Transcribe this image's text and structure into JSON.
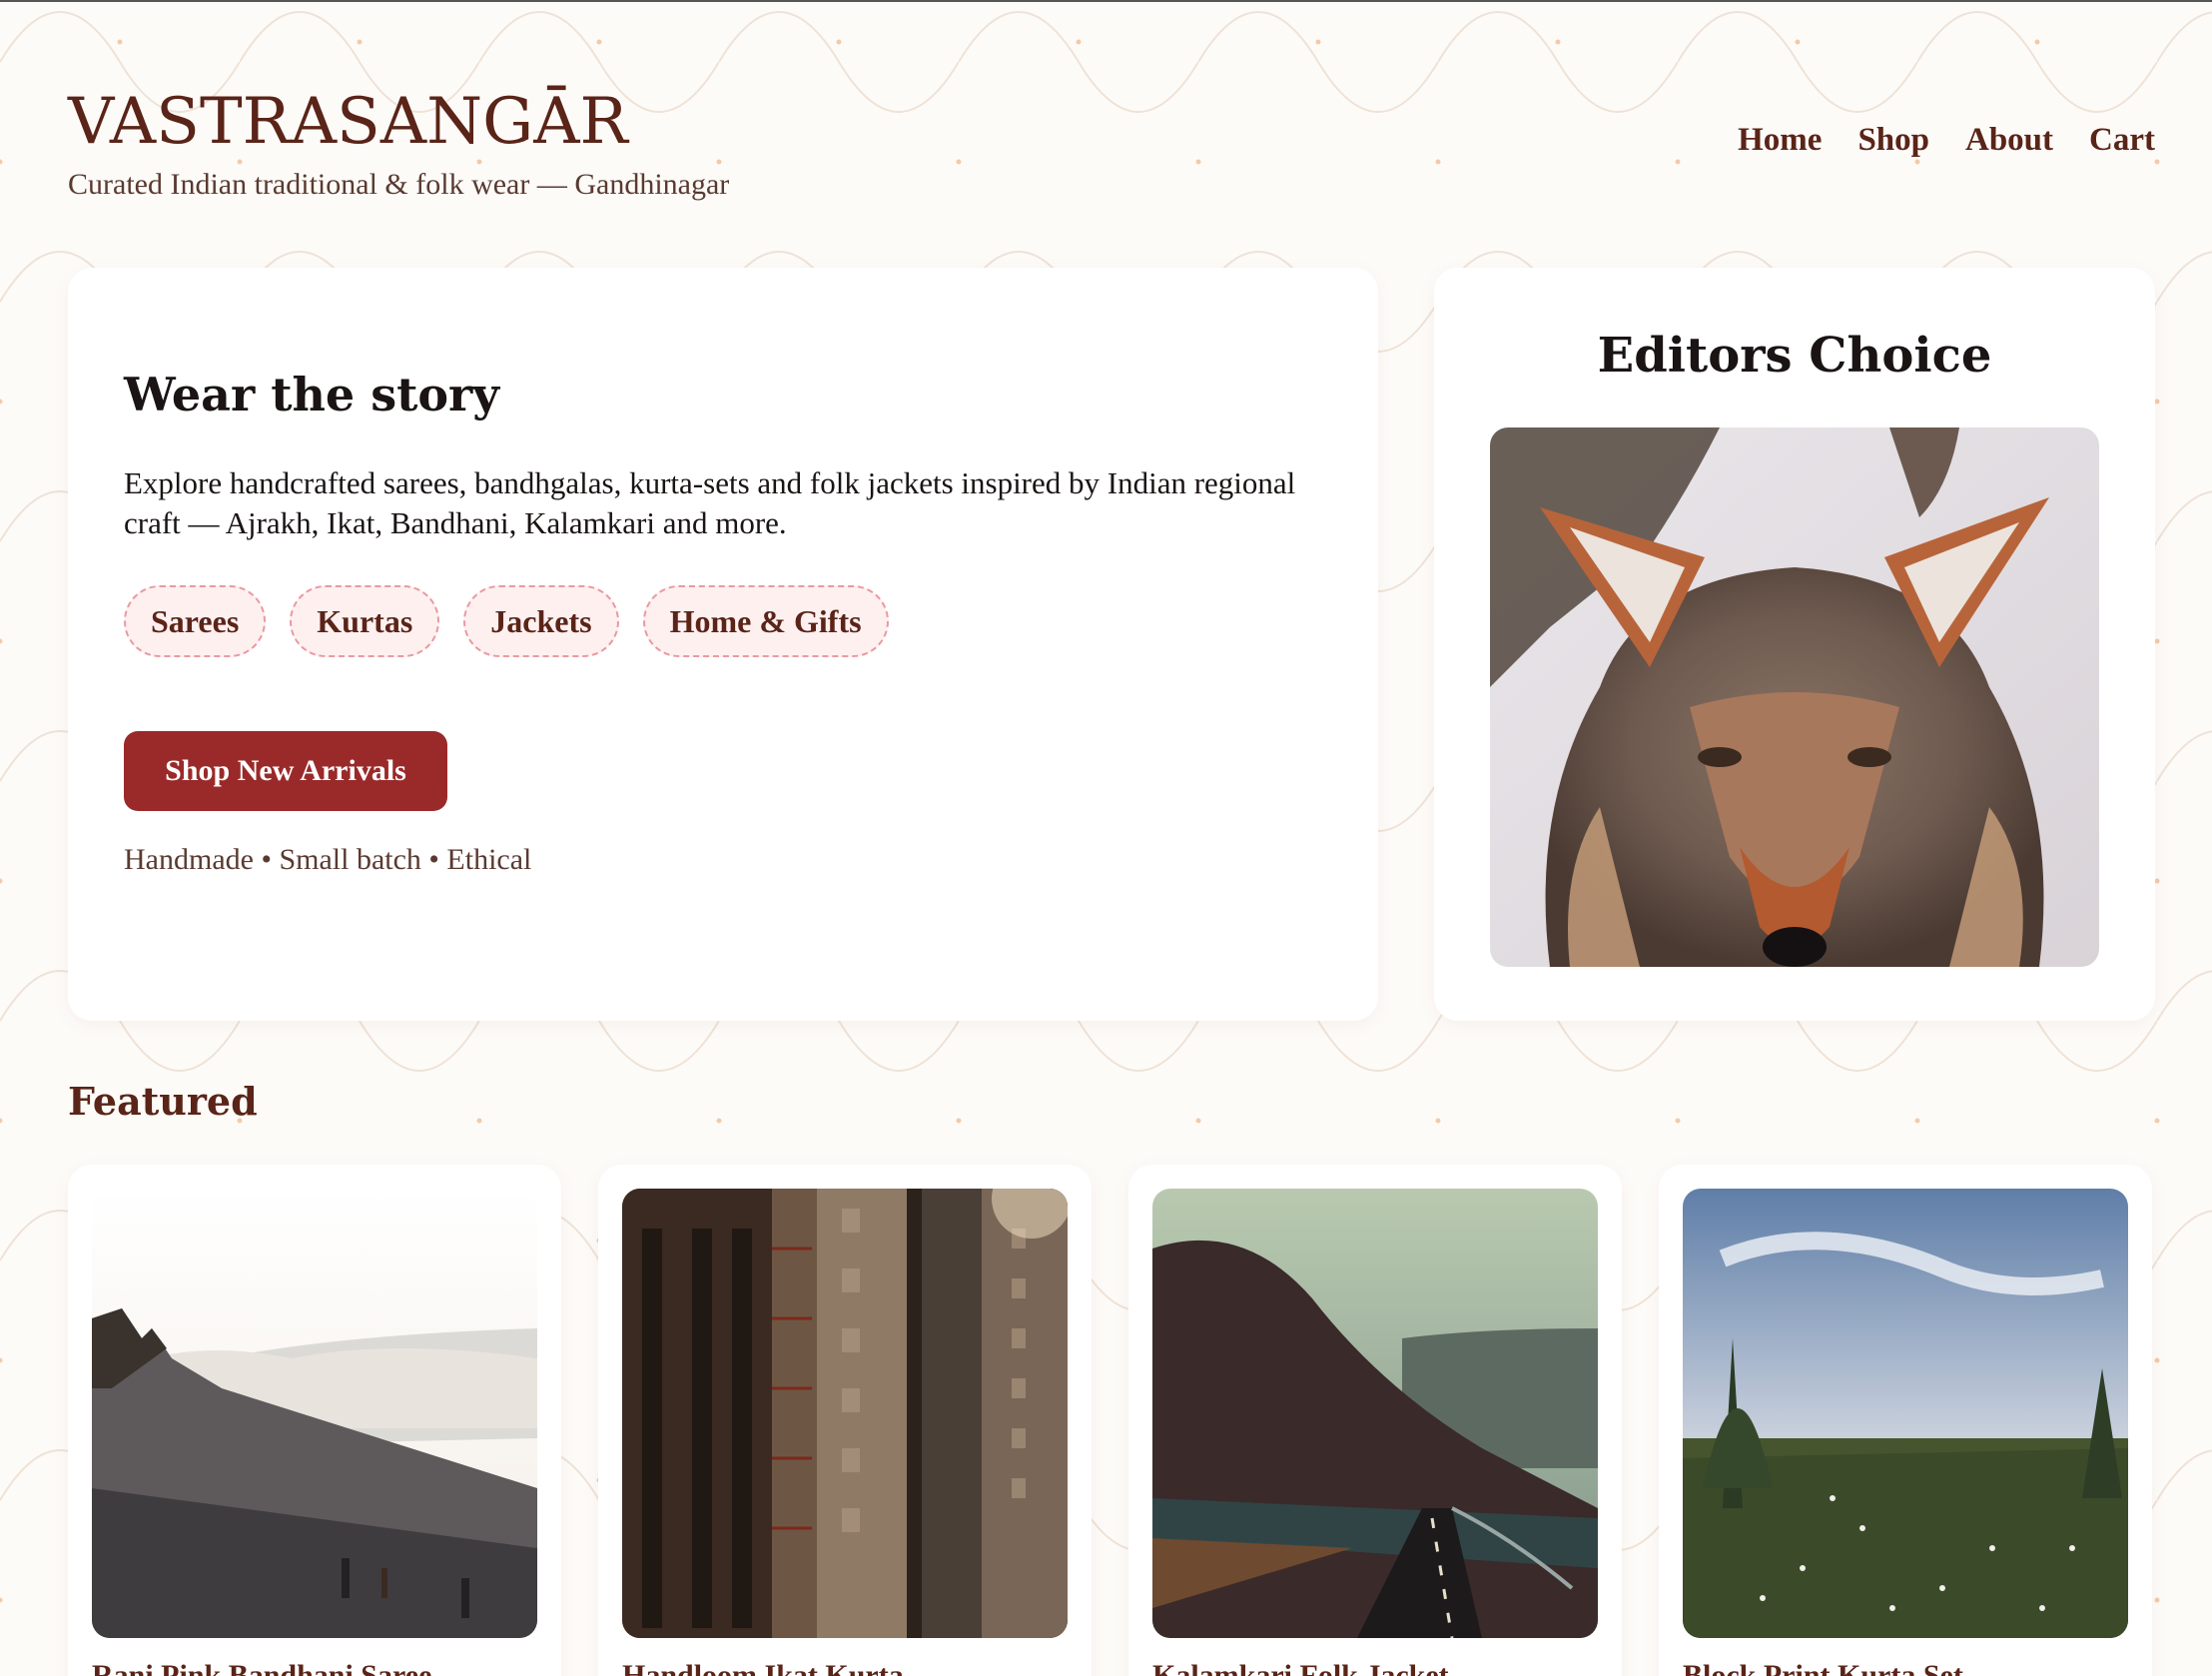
{
  "brand": {
    "name": "VASTRASANGĀR",
    "tagline": "Curated Indian traditional & folk wear — Gandhinagar"
  },
  "nav": [
    "Home",
    "Shop",
    "About",
    "Cart"
  ],
  "hero": {
    "title": "Wear the story",
    "description": "Explore handcrafted sarees, bandhgalas, kurta-sets and folk jackets inspired by Indian regional craft — Ajrakh, Ikat, Bandhani, Kalamkari and more.",
    "categories": [
      "Sarees",
      "Kurtas",
      "Jackets",
      "Home & Gifts"
    ],
    "cta_label": "Shop New Arrivals",
    "note": "Handmade • Small batch • Ethical"
  },
  "editors_choice": {
    "title": "Editors Choice",
    "image": "coyote-photo"
  },
  "featured": {
    "title": "Featured",
    "products": [
      {
        "name": "Rani Pink Bandhani Saree",
        "image": "mountain-clouds-photo"
      },
      {
        "name": "Handloom Ikat Kurta",
        "image": "city-buildings-photo"
      },
      {
        "name": "Kalamkari Folk Jacket",
        "image": "valley-road-photo"
      },
      {
        "name": "Block Print Kurta Set",
        "image": "meadow-sky-photo"
      }
    ]
  },
  "colors": {
    "brand": "#5a2418",
    "accent": "#9a2a2a",
    "chip_bg": "#fff0f0",
    "chip_border": "#e89aa0",
    "page_bg": "#fdfbf8"
  }
}
